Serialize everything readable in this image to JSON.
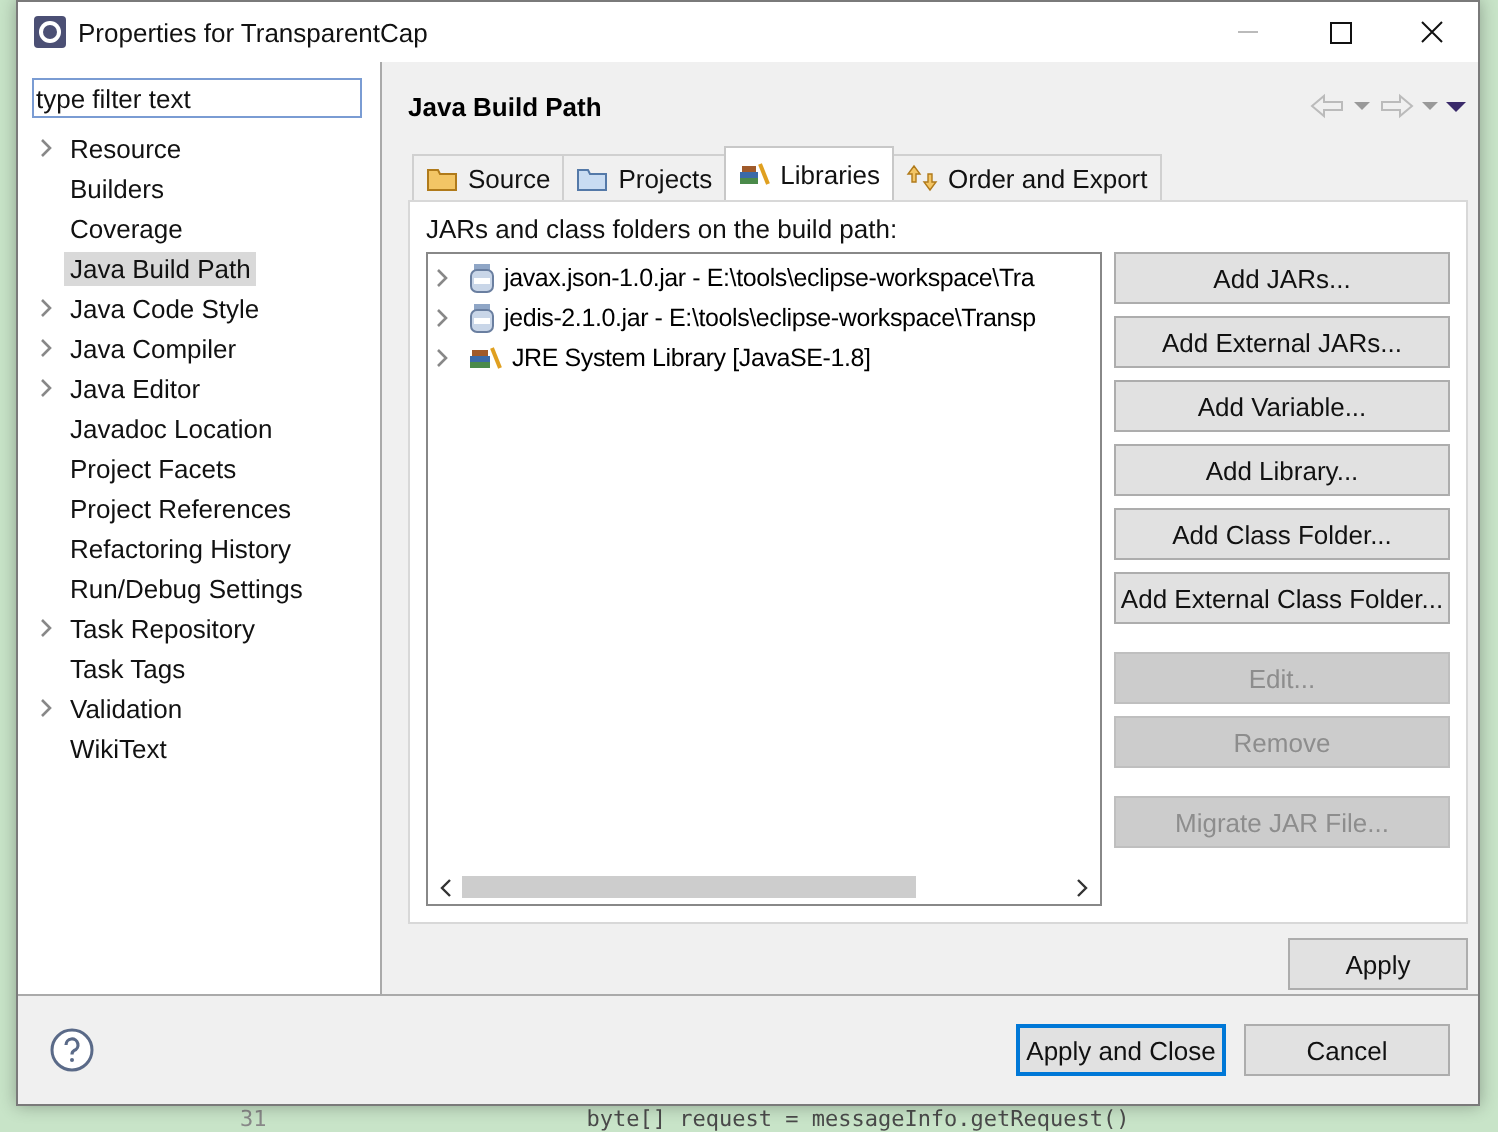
{
  "editor": {
    "line_number": "31",
    "code": "byte[] request = messageInfo.getRequest()"
  },
  "window": {
    "title": "Properties for TransparentCap"
  },
  "filter": {
    "value": "type filter text"
  },
  "tree": [
    {
      "label": "Resource",
      "expandable": true,
      "selected": false
    },
    {
      "label": "Builders",
      "expandable": false,
      "selected": false
    },
    {
      "label": "Coverage",
      "expandable": false,
      "selected": false
    },
    {
      "label": "Java Build Path",
      "expandable": false,
      "selected": true
    },
    {
      "label": "Java Code Style",
      "expandable": true,
      "selected": false
    },
    {
      "label": "Java Compiler",
      "expandable": true,
      "selected": false
    },
    {
      "label": "Java Editor",
      "expandable": true,
      "selected": false
    },
    {
      "label": "Javadoc Location",
      "expandable": false,
      "selected": false
    },
    {
      "label": "Project Facets",
      "expandable": false,
      "selected": false
    },
    {
      "label": "Project References",
      "expandable": false,
      "selected": false
    },
    {
      "label": "Refactoring History",
      "expandable": false,
      "selected": false
    },
    {
      "label": "Run/Debug Settings",
      "expandable": false,
      "selected": false
    },
    {
      "label": "Task Repository",
      "expandable": true,
      "selected": false
    },
    {
      "label": "Task Tags",
      "expandable": false,
      "selected": false
    },
    {
      "label": "Validation",
      "expandable": true,
      "selected": false
    },
    {
      "label": "WikiText",
      "expandable": false,
      "selected": false
    }
  ],
  "page": {
    "title": "Java Build Path"
  },
  "tabs": [
    {
      "label": "Source",
      "kind": "source",
      "selected": false
    },
    {
      "label": "Projects",
      "kind": "projects",
      "selected": false
    },
    {
      "label": "Libraries",
      "kind": "libraries",
      "selected": true
    },
    {
      "label": "Order and Export",
      "kind": "order",
      "selected": false
    }
  ],
  "section_label": "JARs and class folders on the build path:",
  "libraries": [
    {
      "label": "javax.json-1.0.jar - E:\\tools\\eclipse-workspace\\Tra",
      "kind": "jar"
    },
    {
      "label": "jedis-2.1.0.jar - E:\\tools\\eclipse-workspace\\Transp",
      "kind": "jar"
    },
    {
      "label": "JRE System Library [JavaSE-1.8]",
      "kind": "jre"
    }
  ],
  "button_groups": [
    {
      "buttons": [
        {
          "label": "Add JARs...",
          "disabled": false
        },
        {
          "label": "Add External JARs...",
          "disabled": false
        },
        {
          "label": "Add Variable...",
          "disabled": false
        },
        {
          "label": "Add Library...",
          "disabled": false
        },
        {
          "label": "Add Class Folder...",
          "disabled": false
        },
        {
          "label": "Add External Class Folder...",
          "disabled": false
        }
      ]
    },
    {
      "buttons": [
        {
          "label": "Edit...",
          "disabled": true
        },
        {
          "label": "Remove",
          "disabled": true
        }
      ]
    },
    {
      "buttons": [
        {
          "label": "Migrate JAR File...",
          "disabled": true
        }
      ]
    }
  ],
  "apply": "Apply",
  "footer": {
    "primary": "Apply and Close",
    "cancel": "Cancel"
  }
}
